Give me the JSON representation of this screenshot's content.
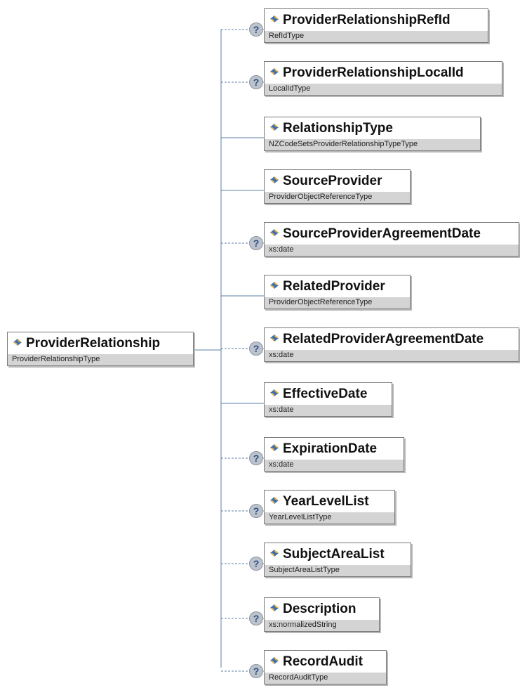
{
  "root": {
    "name": "ProviderRelationship",
    "type": "ProviderRelationshipType"
  },
  "optional_marker": "?",
  "elements": [
    {
      "name": "ProviderRelationshipRefId",
      "type": "RefIdType",
      "optional": true
    },
    {
      "name": "ProviderRelationshipLocalId",
      "type": "LocalIdType",
      "optional": true
    },
    {
      "name": "RelationshipType",
      "type": "NZCodeSetsProviderRelationshipTypeType",
      "optional": false
    },
    {
      "name": "SourceProvider",
      "type": "ProviderObjectReferenceType",
      "optional": false
    },
    {
      "name": "SourceProviderAgreementDate",
      "type": "xs:date",
      "optional": true
    },
    {
      "name": "RelatedProvider",
      "type": "ProviderObjectReferenceType",
      "optional": false
    },
    {
      "name": "RelatedProviderAgreementDate",
      "type": "xs:date",
      "optional": true
    },
    {
      "name": "EffectiveDate",
      "type": "xs:date",
      "optional": false
    },
    {
      "name": "ExpirationDate",
      "type": "xs:date",
      "optional": true
    },
    {
      "name": "YearLevelList",
      "type": "YearLevelListType",
      "optional": true
    },
    {
      "name": "SubjectAreaList",
      "type": "SubjectAreaListType",
      "optional": true
    },
    {
      "name": "Description",
      "type": "xs:normalizedString",
      "optional": true
    },
    {
      "name": "RecordAudit",
      "type": "RecordAuditType",
      "optional": true
    }
  ]
}
